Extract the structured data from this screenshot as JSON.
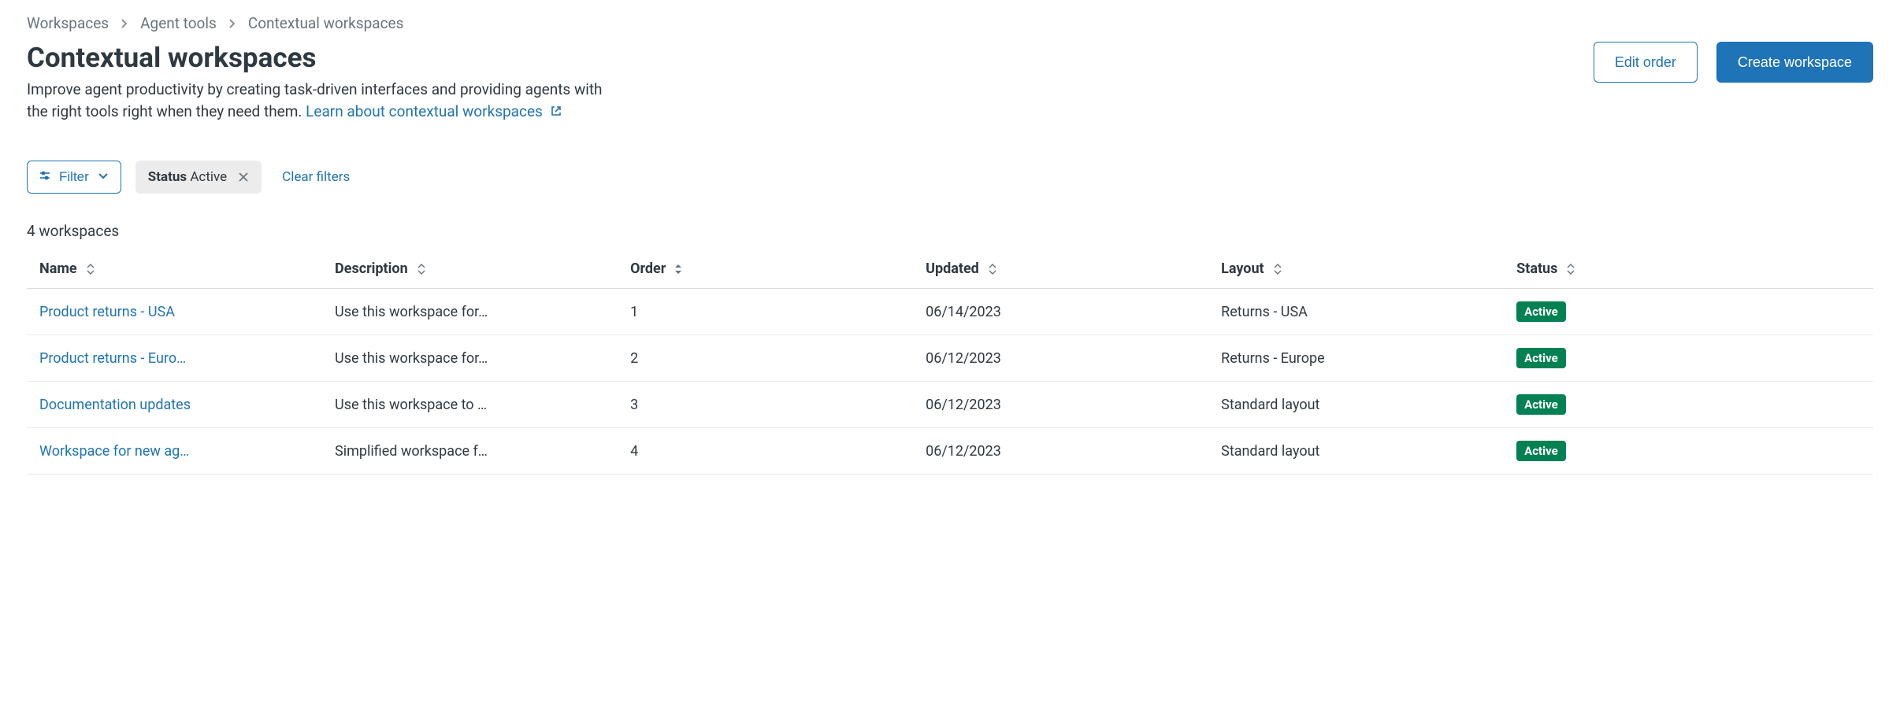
{
  "breadcrumbs": {
    "items": [
      "Workspaces",
      "Agent tools",
      "Contextual workspaces"
    ]
  },
  "header": {
    "title": "Contextual workspaces",
    "description": "Improve agent productivity by creating task-driven interfaces and providing agents with the right tools right when they need them. ",
    "learn_link": "Learn about contextual workspaces",
    "edit_order_label": "Edit order",
    "create_label": "Create workspace"
  },
  "filter": {
    "button_label": "Filter",
    "chip_key": "Status",
    "chip_value": "Active",
    "clear_label": "Clear filters"
  },
  "count_text": "4 workspaces",
  "table": {
    "columns": {
      "name": "Name",
      "description": "Description",
      "order": "Order",
      "updated": "Updated",
      "layout": "Layout",
      "status": "Status"
    },
    "rows": [
      {
        "name": "Product returns - USA",
        "description": "Use this workspace for…",
        "order": "1",
        "updated": "06/14/2023",
        "layout": "Returns - USA",
        "status": "Active"
      },
      {
        "name": "Product returns - Euro…",
        "description": "Use this workspace for…",
        "order": "2",
        "updated": "06/12/2023",
        "layout": "Returns - Europe",
        "status": "Active"
      },
      {
        "name": "Documentation updates",
        "description": "Use this workspace to …",
        "order": "3",
        "updated": "06/12/2023",
        "layout": "Standard layout",
        "status": "Active"
      },
      {
        "name": "Workspace for new ag…",
        "description": "Simplified workspace f…",
        "order": "4",
        "updated": "06/12/2023",
        "layout": "Standard layout",
        "status": "Active"
      }
    ]
  }
}
